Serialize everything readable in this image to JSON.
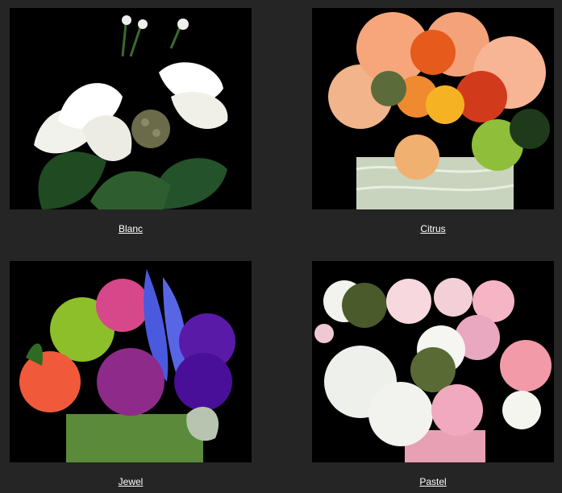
{
  "products": [
    {
      "name": "Blanc",
      "image": "white-lilies-arrangement-image"
    },
    {
      "name": "Citrus",
      "image": "orange-flowers-arrangement-image"
    },
    {
      "name": "Jewel",
      "image": "purple-pink-flowers-arrangement-image"
    },
    {
      "name": "Pastel",
      "image": "pastel-pink-flowers-arrangement-image"
    }
  ],
  "colors": {
    "page_background": "#252525",
    "photo_background": "#000000",
    "caption_text": "#ffffff"
  }
}
